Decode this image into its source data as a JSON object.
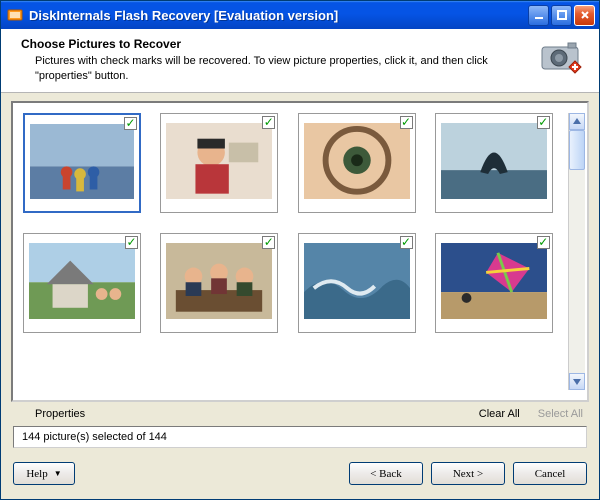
{
  "window": {
    "title": "DiskInternals Flash Recovery [Evaluation version]"
  },
  "header": {
    "heading": "Choose Pictures to Recover",
    "description": "Pictures with check marks will be recovered. To view picture properties, click it, and then click \"properties\" button."
  },
  "thumbnails": [
    {
      "name": "photo-beach-people",
      "checked": true,
      "selected": true
    },
    {
      "name": "photo-woman-classroom",
      "checked": true,
      "selected": false
    },
    {
      "name": "photo-eye-glasses",
      "checked": true,
      "selected": false
    },
    {
      "name": "photo-whale-tail",
      "checked": true,
      "selected": false
    },
    {
      "name": "photo-house-family",
      "checked": true,
      "selected": false
    },
    {
      "name": "photo-meeting-table",
      "checked": true,
      "selected": false
    },
    {
      "name": "photo-ocean-wave",
      "checked": true,
      "selected": false
    },
    {
      "name": "photo-kite-beach",
      "checked": true,
      "selected": false
    }
  ],
  "links": {
    "properties": "Properties",
    "clear_all": "Clear All",
    "select_all": "Select All"
  },
  "status": {
    "text": "144 picture(s) selected of 144"
  },
  "buttons": {
    "help": "Help",
    "back": "< Back",
    "next": "Next >",
    "cancel": "Cancel"
  },
  "checkmark_glyph": "✓"
}
